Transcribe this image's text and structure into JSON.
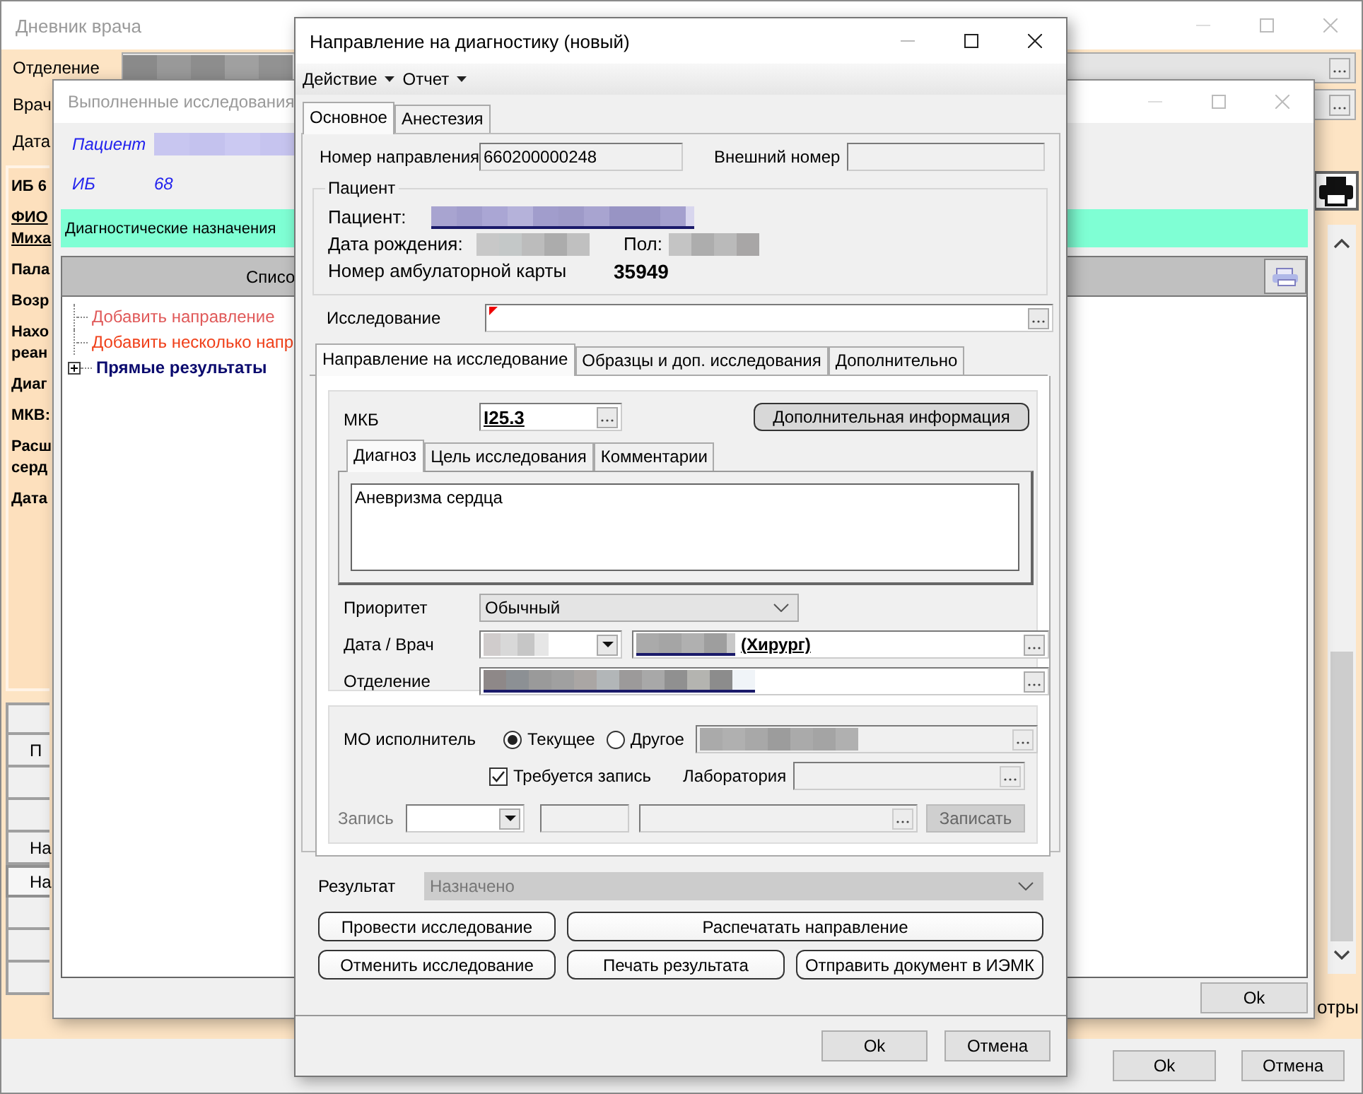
{
  "main_window": {
    "title": "Дневник врача",
    "filters": [
      {
        "label": "Отделение",
        "kind": "lookup"
      },
      {
        "label": "Врач",
        "kind": "lookup_blank"
      },
      {
        "label": "Дата",
        "kind": "date"
      }
    ],
    "patient_info": [
      {
        "lines": [
          "ИБ 6"
        ],
        "kind": "plain"
      },
      {
        "lines": [
          "ФИО",
          "Миха"
        ],
        "kind": "link"
      },
      {
        "lines": [
          "Пала"
        ],
        "kind": "plain"
      },
      {
        "lines": [
          "Возр"
        ],
        "kind": "plain"
      },
      {
        "lines": [
          "Нахо",
          "реан"
        ],
        "kind": "plain"
      },
      {
        "lines": [
          "Диаг"
        ],
        "kind": "plain"
      },
      {
        "lines": [
          "МКВ:"
        ],
        "kind": "plain"
      },
      {
        "lines": [
          "Расш",
          "серд"
        ],
        "kind": "plain"
      },
      {
        "lines": [
          "Дата"
        ],
        "kind": "plain"
      }
    ],
    "side_buttons": [
      {
        "selected": false
      },
      {
        "label": "П",
        "selected": false
      },
      {
        "selected": false
      },
      {
        "selected": false
      },
      {
        "label": "На",
        "selected": false
      },
      {
        "label": "На",
        "selected": true
      },
      {
        "selected": false
      },
      {
        "selected": false
      },
      {
        "selected": false
      }
    ],
    "right_label": "отры",
    "buttons": [
      "Ok",
      "Отмена"
    ]
  },
  "results_window": {
    "title": "Выполненные исследования",
    "patient_label": "Пациент",
    "ib_label": "ИБ",
    "ib_value": "68",
    "section_title": "Диагностические назначения",
    "list_header": "Списо",
    "tree": [
      {
        "label": "Добавить направление",
        "kind": "action",
        "color": "#e05a5a"
      },
      {
        "label": "Добавить несколько напр",
        "kind": "action",
        "color": "#f0401a"
      },
      {
        "label": "Прямые результаты",
        "kind": "group",
        "expanded": false
      }
    ],
    "buttons": [
      "Ok"
    ]
  },
  "referral_window": {
    "title": "Направление на диагностику (новый)",
    "menu": [
      "Действие",
      "Отчет"
    ],
    "tabs": [
      {
        "label": "Основное",
        "selected": true
      },
      {
        "label": "Анестезия",
        "selected": false
      }
    ],
    "referral_number_label": "Номер направления",
    "referral_number": "660200000248",
    "external_number_label": "Внешний номер",
    "patient_group": {
      "legend": "Пациент",
      "patient_label": "Пациент:",
      "birth_label": "Дата рождения:",
      "sex_label": "Пол:",
      "card_label": "Номер амбулаторной карты",
      "card_number": "35949"
    },
    "study_label": "Исследование",
    "study_required": true,
    "inner_tabs": [
      {
        "label": "Направление на исследование",
        "selected": true
      },
      {
        "label": "Образцы и доп. исследования",
        "selected": false
      },
      {
        "label": "Дополнительно",
        "selected": false
      }
    ],
    "mkb_label": "МКБ",
    "mkb_value": "I25.3",
    "extra_info_button": "Дополнительная информация",
    "diag_tabs": [
      {
        "label": "Диагноз",
        "selected": true
      },
      {
        "label": "Цель исследования",
        "selected": false
      },
      {
        "label": "Комментарии",
        "selected": false
      }
    ],
    "diagnosis": "Аневризма сердца",
    "priority_label": "Приоритет",
    "priority": "Обычный",
    "date_doctor_label": "Дата / Врач",
    "doctor_role": "(Хирург)",
    "department_label": "Отделение",
    "performer_label": "МО исполнитель",
    "performer_options": [
      {
        "label": "Текущее",
        "selected": true
      },
      {
        "label": "Другое",
        "selected": false
      }
    ],
    "booking_required": {
      "label": "Требуется запись",
      "checked": true
    },
    "lab_label": "Лаборатория",
    "booking_label": "Запись",
    "booking_disabled": true,
    "book_button": "Записать",
    "result_label": "Результат",
    "result": "Назначено",
    "result_disabled": true,
    "action_buttons": [
      [
        "Провести исследование",
        "Распечатать направление"
      ],
      [
        "Отменить исследование",
        "Печать результата",
        "Отправить документ в ИЭМК"
      ]
    ],
    "footer_buttons": [
      "Ok",
      "Отмена"
    ]
  }
}
